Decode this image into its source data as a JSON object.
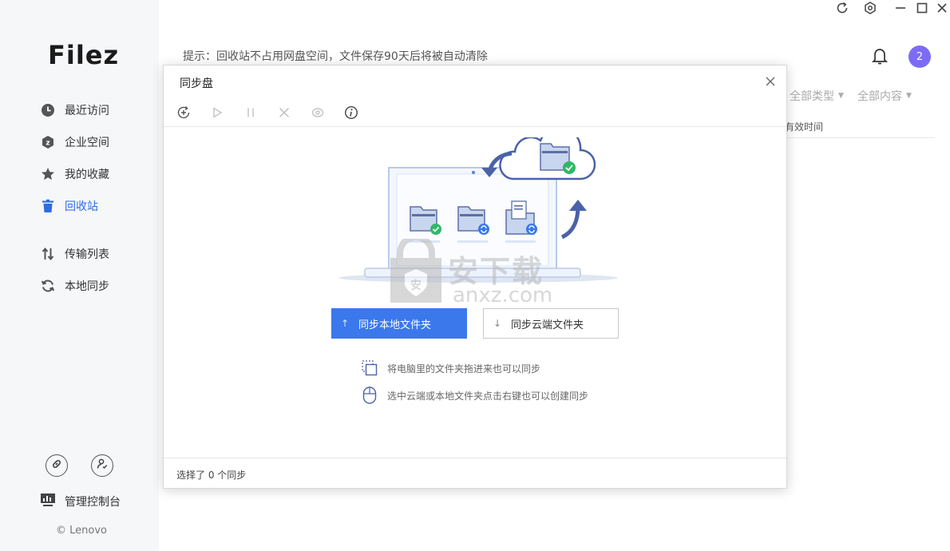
{
  "app": {
    "logo": "Filez"
  },
  "sidebar": {
    "items": [
      {
        "label": "最近访问",
        "icon": "clock-icon",
        "active": false
      },
      {
        "label": "企业空间",
        "icon": "enterprise-icon",
        "active": false
      },
      {
        "label": "我的收藏",
        "icon": "star-icon",
        "active": false
      },
      {
        "label": "回收站",
        "icon": "trash-icon",
        "active": true
      },
      {
        "label": "传输列表",
        "icon": "transfer-icon",
        "active": false
      },
      {
        "label": "本地同步",
        "icon": "sync-icon",
        "active": false
      }
    ],
    "bottom_icons": [
      "link-icon",
      "user-check-icon"
    ],
    "admin_label": "管理控制台",
    "copyright": "© Lenovo"
  },
  "header": {
    "hint": "提示：回收站不占用网盘空间，文件保存90天后将被自动清除",
    "notification_count": "2",
    "window_controls": [
      "refresh-icon",
      "settings-icon",
      "minimize-icon",
      "maximize-icon",
      "close-icon"
    ]
  },
  "filters": {
    "type": "全部类型",
    "content": "全部内容"
  },
  "table": {
    "column_partial": "有效时间"
  },
  "dialog": {
    "title": "同步盘",
    "toolbar": [
      "add-sync-icon",
      "play-icon",
      "pause-icon",
      "delete-icon",
      "view-icon",
      "info-icon"
    ],
    "btn_local": "同步本地文件夹",
    "btn_cloud": "同步云端文件夹",
    "btn_local_arrow": "↑",
    "btn_cloud_arrow": "↓",
    "tip_drag": "将电脑里的文件夹拖进来也可以同步",
    "tip_right_click": "选中云端或本地文件夹点击右键也可以创建同步",
    "status": "选择了 0 个同步"
  },
  "watermark": {
    "text": "安下载",
    "url": "anxz.com"
  },
  "colors": {
    "accent": "#3a78ec",
    "avatar": "#7b6cf6",
    "sidebar_bg": "#f6f7f9",
    "check": "#2fb866"
  }
}
